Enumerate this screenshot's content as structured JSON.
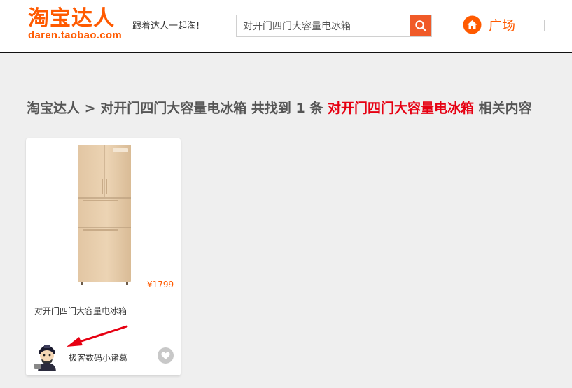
{
  "header": {
    "logo_title": "淘宝达人",
    "logo_url": "daren.taobao.com",
    "slogan": "跟着达人一起淘!",
    "search": {
      "value": "对开门四门大容量电冰箱"
    },
    "plaza_label": "广场"
  },
  "results": {
    "breadcrumb_root": "淘宝达人",
    "separator": ">",
    "query": "对开门四门大容量电冰箱",
    "found_prefix": "共找到",
    "count": "1",
    "count_unit": "条",
    "keyword": "对开门四门大容量电冰箱",
    "suffix": "相关内容"
  },
  "cards": [
    {
      "price": "¥1799",
      "title": "对开门四门大容量电冰箱",
      "author": "极客数码小诸葛"
    }
  ],
  "colors": {
    "brand": "#ff5a00",
    "keyword": "#e60012",
    "search_button": "#f05a28"
  },
  "icons": [
    "search-icon",
    "home-icon",
    "heart-icon"
  ]
}
